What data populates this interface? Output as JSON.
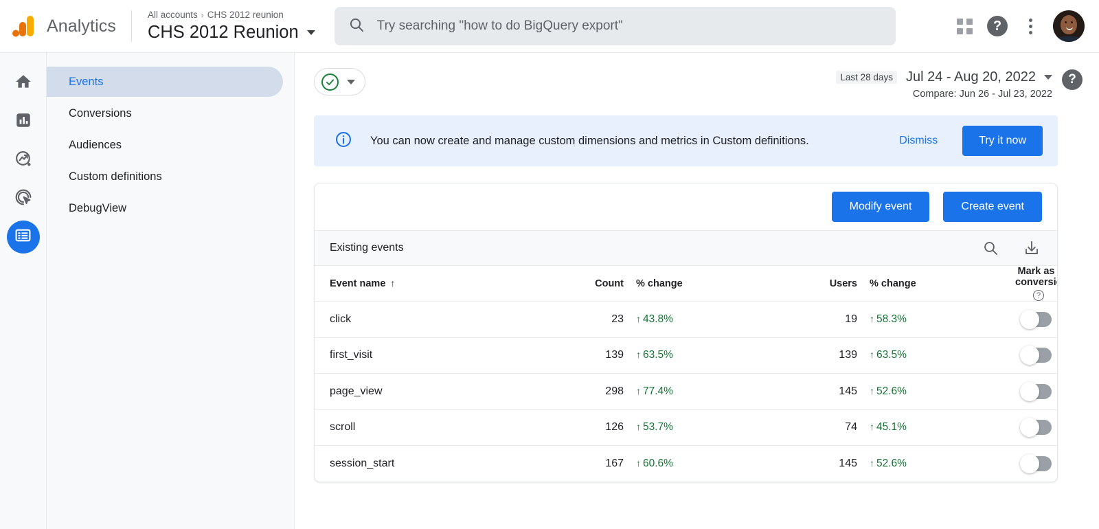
{
  "topbar": {
    "logo_icon": "google-analytics-logo",
    "brand": "Analytics",
    "breadcrumb_root": "All accounts",
    "breadcrumb_sep": "›",
    "breadcrumb_property": "CHS 2012 reunion",
    "property_name": "CHS 2012 Reunion",
    "search_placeholder": "Try searching \"how to do BigQuery export\"",
    "search_value": "",
    "search_icon": "search-icon",
    "apps_icon": "apps-grid-icon",
    "help_icon": "help-icon",
    "more_icon": "more-vertical-icon",
    "avatar": "user-avatar"
  },
  "rail": {
    "items": [
      {
        "name": "home",
        "icon": "home-icon",
        "active": false
      },
      {
        "name": "reports",
        "icon": "bar-chart-icon",
        "active": false
      },
      {
        "name": "explore",
        "icon": "explore-trending-icon",
        "active": false
      },
      {
        "name": "advertising",
        "icon": "advertising-target-icon",
        "active": false
      },
      {
        "name": "configure",
        "icon": "list-configure-icon",
        "active": true
      }
    ]
  },
  "sidebar": {
    "items": [
      {
        "label": "Events",
        "active": true
      },
      {
        "label": "Conversions",
        "active": false
      },
      {
        "label": "Audiences",
        "active": false
      },
      {
        "label": "Custom definitions",
        "active": false
      },
      {
        "label": "DebugView",
        "active": false
      }
    ]
  },
  "toolbar": {
    "filter_icon": "check-circle-icon",
    "filter_caret_icon": "caret-down-icon",
    "last_period_badge": "Last 28 days",
    "date_range": "Jul 24 - Aug 20, 2022",
    "date_caret_icon": "caret-down-icon",
    "compare": "Compare: Jun 26 - Jul 23, 2022",
    "help_icon": "help-circle-icon"
  },
  "banner": {
    "info_icon": "info-icon",
    "message": "You can now create and manage custom dimensions and metrics in Custom definitions.",
    "dismiss_label": "Dismiss",
    "cta_label": "Try it now"
  },
  "card": {
    "modify_label": "Modify event",
    "create_label": "Create event",
    "subheader_title": "Existing events",
    "search_icon": "search-icon",
    "download_icon": "download-icon"
  },
  "table": {
    "columns": {
      "event_name": "Event name",
      "sort_arrow": "↑",
      "count": "Count",
      "change_1": "% change",
      "users": "Users",
      "change_2": "% change",
      "mark_as_conversion": "Mark as conversion",
      "help_glyph": "?"
    },
    "up_arrow": "↑",
    "rows": [
      {
        "event_name": "click",
        "count": "23",
        "count_change": "43.8%",
        "users": "19",
        "users_change": "58.3%",
        "conversion_on": false
      },
      {
        "event_name": "first_visit",
        "count": "139",
        "count_change": "63.5%",
        "users": "139",
        "users_change": "63.5%",
        "conversion_on": false
      },
      {
        "event_name": "page_view",
        "count": "298",
        "count_change": "77.4%",
        "users": "145",
        "users_change": "52.6%",
        "conversion_on": false
      },
      {
        "event_name": "scroll",
        "count": "126",
        "count_change": "53.7%",
        "users": "74",
        "users_change": "45.1%",
        "conversion_on": false
      },
      {
        "event_name": "session_start",
        "count": "167",
        "count_change": "60.6%",
        "users": "145",
        "users_change": "52.6%",
        "conversion_on": false
      }
    ]
  },
  "colors": {
    "brand_blue": "#1a73e8",
    "positive_green": "#137333",
    "banner_bg": "#e8f0fe",
    "nav_active_bg": "#d3dcea",
    "text_primary": "#202124",
    "text_secondary": "#5f6368",
    "logo_orange": "#e8710a",
    "logo_yellow": "#f9ab00"
  }
}
